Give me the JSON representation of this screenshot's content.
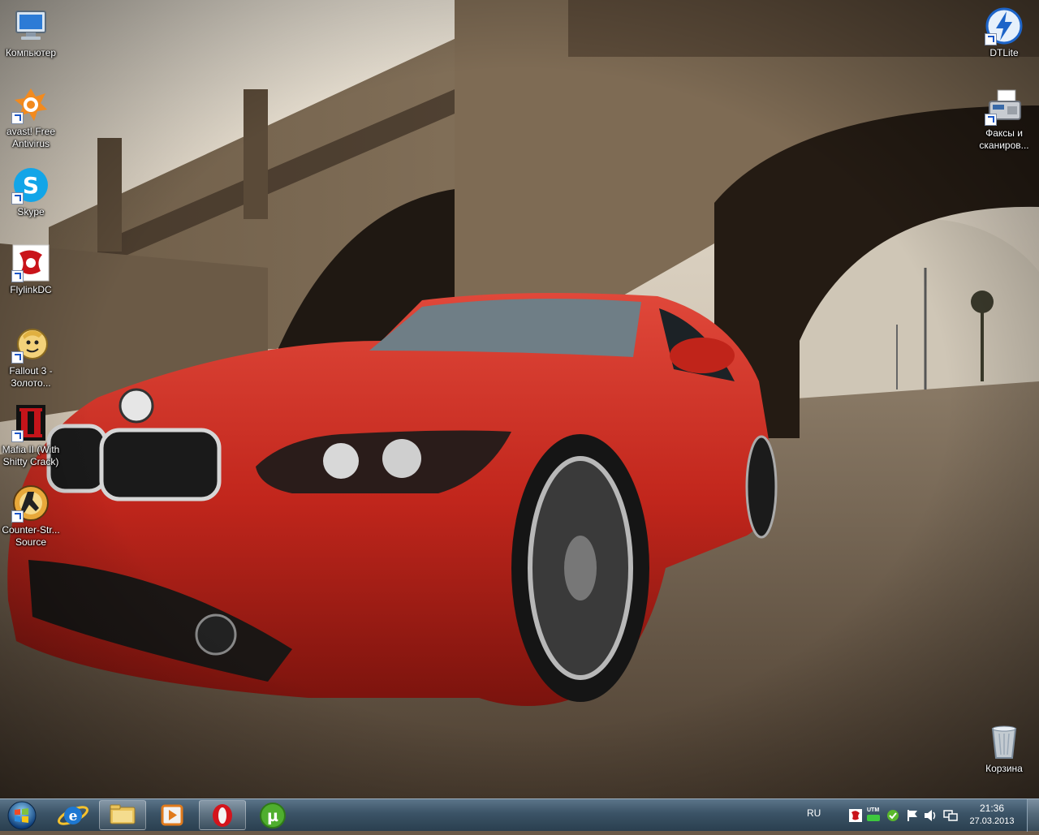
{
  "desktop": {
    "icons": [
      {
        "label": "Компьютер",
        "icon": "computer-icon",
        "shortcut": false
      },
      {
        "label": "avast! Free Antivirus",
        "icon": "avast-icon",
        "shortcut": true
      },
      {
        "label": "Skype",
        "icon": "skype-icon",
        "shortcut": true
      },
      {
        "label": "FlylinkDC",
        "icon": "flylinkdc-icon",
        "shortcut": true
      },
      {
        "label": "Fallout 3 - Золото...",
        "icon": "fallout3-icon",
        "shortcut": true
      },
      {
        "label": "Mafia II (With Shitty Crack)",
        "icon": "mafia2-icon",
        "shortcut": true
      },
      {
        "label": "Counter-Str... Source",
        "icon": "counter-strike-icon",
        "shortcut": true
      },
      {
        "label": "DTLite",
        "icon": "dtlite-icon",
        "shortcut": true
      },
      {
        "label": "Факсы и сканиров...",
        "icon": "fax-scanner-icon",
        "shortcut": true
      },
      {
        "label": "Корзина",
        "icon": "recycle-bin-icon",
        "shortcut": false
      }
    ]
  },
  "taskbar": {
    "start": "start-orb-icon",
    "pinned": [
      "internet-explorer-icon",
      "explorer-folder-icon",
      "media-player-icon",
      "opera-icon",
      "utorrent-icon"
    ],
    "tray": {
      "language": "RU",
      "icons": [
        "flylinkdc-tray-icon",
        "utm-tray-icon",
        "avast-tray-icon",
        "action-center-flag-icon",
        "volume-icon",
        "network-icon"
      ],
      "utm_label": "UTM",
      "time": "21:36",
      "date": "27.03.2013"
    }
  },
  "colors": {
    "taskbar_top": "#5b7489",
    "taskbar_bottom": "#2a3f4f",
    "car_red": "#c8281e"
  }
}
